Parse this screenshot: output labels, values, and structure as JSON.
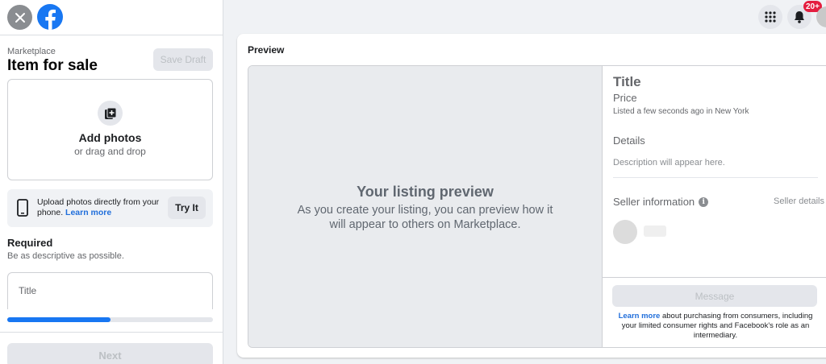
{
  "header": {
    "notifications_badge": "20+"
  },
  "form": {
    "breadcrumb": "Marketplace",
    "title": "Item for sale",
    "save_draft": "Save Draft",
    "add_photos": "Add photos",
    "drag_drop": "or drag and drop",
    "upload_text": "Upload photos directly from your phone.",
    "learn_more": "Learn more",
    "try_it": "Try It",
    "required": "Required",
    "required_hint": "Be as descriptive as possible.",
    "title_placeholder": "Title",
    "progress": 0.5,
    "next": "Next"
  },
  "preview": {
    "label": "Preview",
    "heading": "Your listing preview",
    "subtext": "As you create your listing, you can preview how it will appear to others on Marketplace.",
    "title": "Title",
    "price": "Price",
    "listed": "Listed a few seconds ago in New York",
    "details": "Details",
    "description": "Description will appear here.",
    "seller_info": "Seller information",
    "seller_details": "Seller details",
    "message": "Message",
    "legal_link": "Learn more",
    "legal_text": " about purchasing from consumers, including your limited consumer rights and Facebook's role as an intermediary."
  },
  "colors": {
    "accent": "#1877f2",
    "badge": "#e41e3f"
  }
}
